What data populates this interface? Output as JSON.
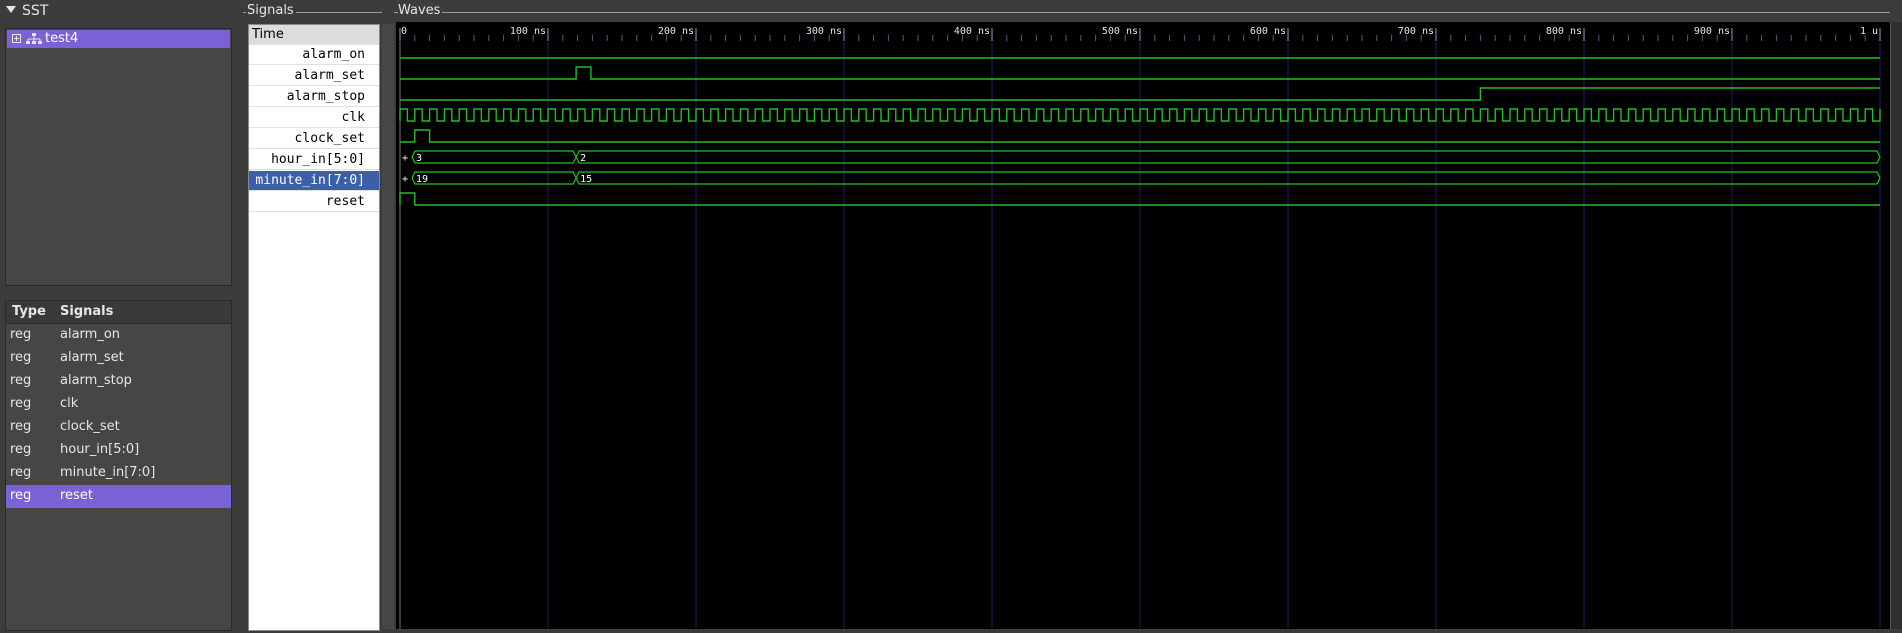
{
  "sst": {
    "title": "SST",
    "tree": [
      {
        "label": "test4"
      }
    ]
  },
  "signal_list": {
    "headers": {
      "type": "Type",
      "signals": "Signals"
    },
    "rows": [
      {
        "type": "reg",
        "name": "alarm_on"
      },
      {
        "type": "reg",
        "name": "alarm_set"
      },
      {
        "type": "reg",
        "name": "alarm_stop"
      },
      {
        "type": "reg",
        "name": "clk"
      },
      {
        "type": "reg",
        "name": "clock_set"
      },
      {
        "type": "reg",
        "name": "hour_in[5:0]"
      },
      {
        "type": "reg",
        "name": "minute_in[7:0]"
      },
      {
        "type": "reg",
        "name": "reset"
      }
    ],
    "selected_index": 7
  },
  "signals_panel": {
    "title": "Signals",
    "time_label": "Time",
    "rows": [
      "alarm_on",
      "alarm_set",
      "alarm_stop",
      "clk",
      "clock_set",
      "hour_in[5:0]",
      "minute_in[7:0]",
      "reset"
    ],
    "selected_index": 6
  },
  "waves_panel": {
    "title": "Waves",
    "timeline_labels": [
      "0",
      "100 ns",
      "200 ns",
      "300 ns",
      "400 ns",
      "500 ns",
      "600 ns",
      "700 ns",
      "800 ns",
      "900 ns",
      "1 u"
    ],
    "time_end_ns": 1000,
    "colors": {
      "wave": "#22c022",
      "grid": "#20206a",
      "background": "#000000",
      "ruler_text": "#e6e6e6"
    },
    "waves": [
      {
        "name": "alarm_on",
        "kind": "bit",
        "initial": 0,
        "transitions": []
      },
      {
        "name": "alarm_set",
        "kind": "bit",
        "initial": 0,
        "transitions": [
          [
            119,
            1
          ],
          [
            129,
            0
          ]
        ]
      },
      {
        "name": "alarm_stop",
        "kind": "bit",
        "initial": 0,
        "transitions": [
          [
            730,
            1
          ]
        ]
      },
      {
        "name": "clk",
        "kind": "clock",
        "period_ns": 10
      },
      {
        "name": "clock_set",
        "kind": "bit",
        "initial": 0,
        "transitions": [
          [
            10,
            1
          ],
          [
            20,
            0
          ]
        ]
      },
      {
        "name": "hour_in[5:0]",
        "kind": "bus",
        "segments": [
          {
            "from": 0,
            "value": "3"
          },
          {
            "from": 119,
            "value": "2"
          }
        ]
      },
      {
        "name": "minute_in[7:0]",
        "kind": "bus",
        "segments": [
          {
            "from": 0,
            "value": "19"
          },
          {
            "from": 119,
            "value": "15"
          }
        ]
      },
      {
        "name": "reset",
        "kind": "bit",
        "initial": 1,
        "transitions": [
          [
            10,
            0
          ]
        ]
      }
    ]
  }
}
